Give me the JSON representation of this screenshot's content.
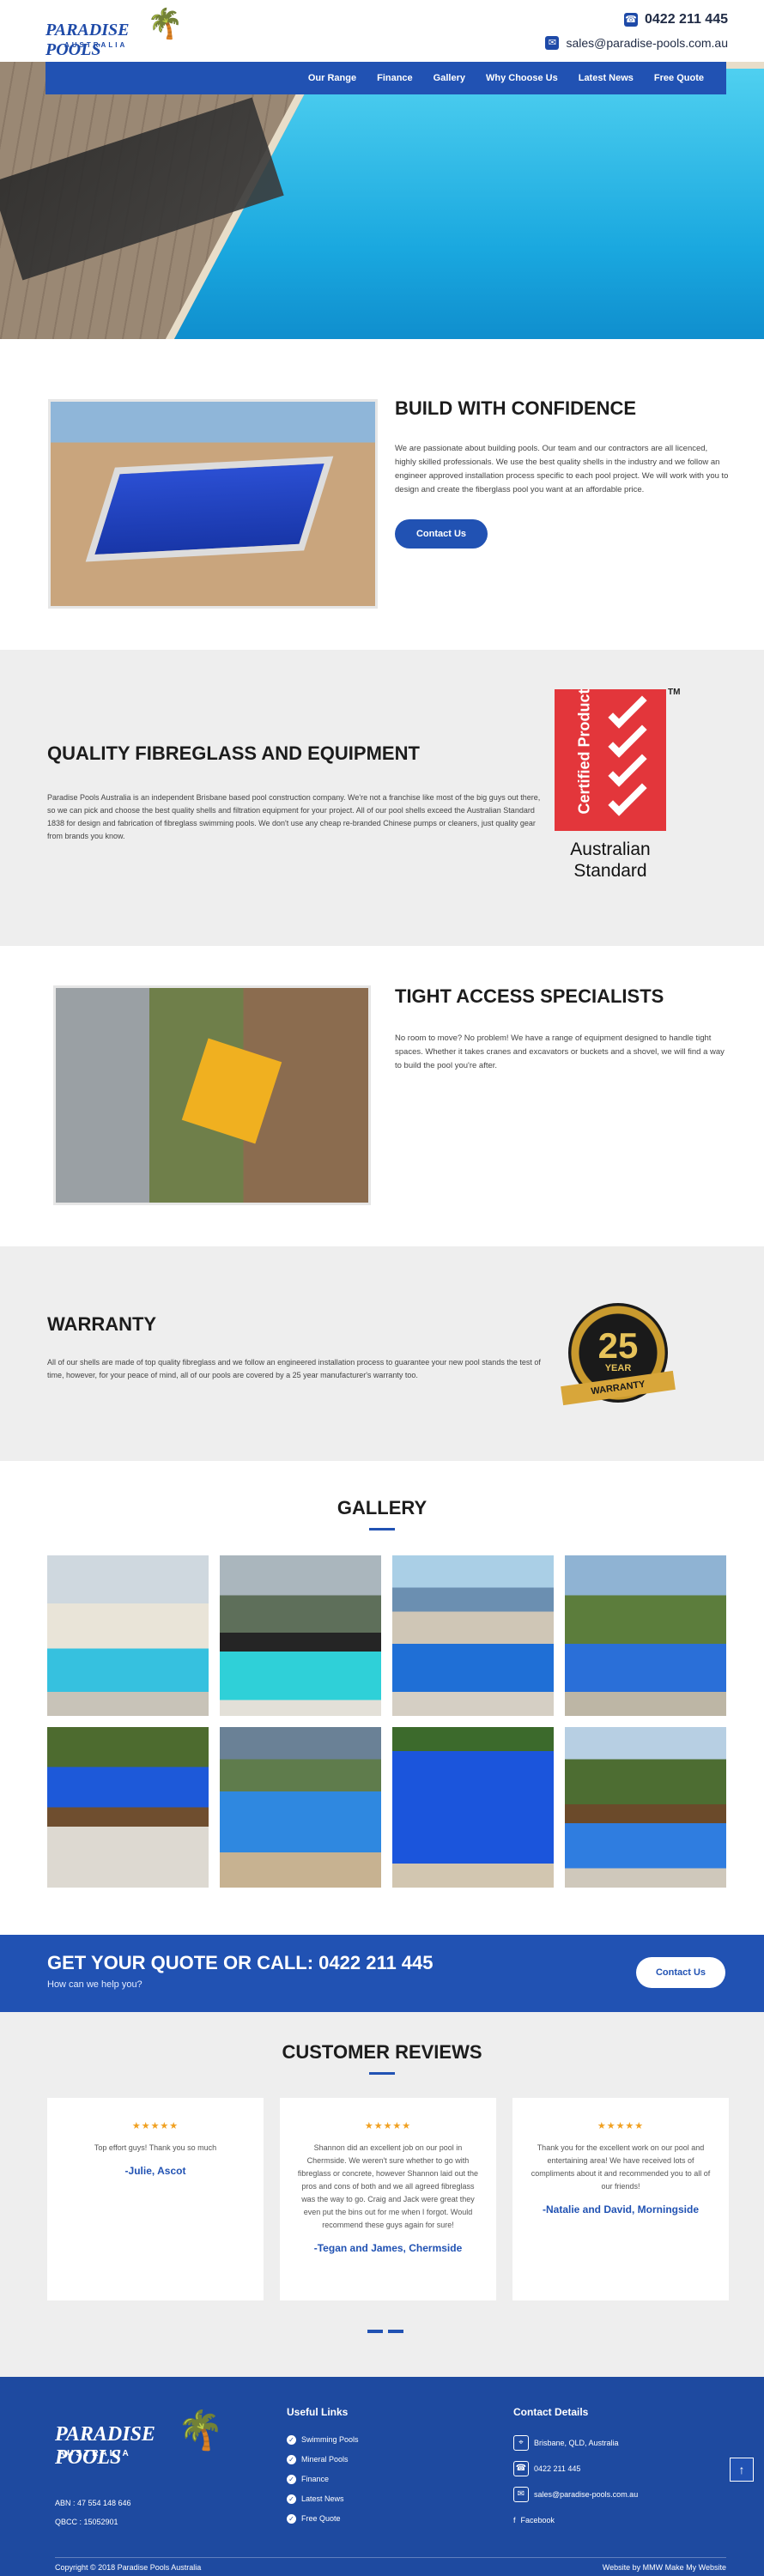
{
  "header": {
    "logo_text": "PARADISE POOLS",
    "logo_subtext": "AUSTRALIA",
    "phone": "0422 211 445",
    "email": "sales@paradise-pools.com.au"
  },
  "nav": {
    "items": [
      {
        "label": "Our Range"
      },
      {
        "label": "Finance"
      },
      {
        "label": "Gallery"
      },
      {
        "label": "Why Choose Us"
      },
      {
        "label": "Latest News"
      },
      {
        "label": "Free Quote"
      }
    ]
  },
  "build": {
    "title": "BUILD WITH CONFIDENCE",
    "text": "We are passionate about building pools. Our team and our contractors are all licenced, highly skilled professionals. We use the best quality shells in the industry and we follow an engineer approved installation process specific to each pool project. We will work with you to design and create the fiberglass pool you want at an affordable price.",
    "button": "Contact Us"
  },
  "quality": {
    "title": "QUALITY FIBREGLASS AND EQUIPMENT",
    "text": "Paradise Pools Australia is an independent Brisbane based pool construction company. We're not a franchise like most of the big guys out there, so we can pick and choose the best quality shells and filtration equipment for your project. All of our pool shells exceed the Australian Standard 1838 for design and fabrication of fibreglass swimming pools. We don't use any cheap re-branded Chinese pumps or cleaners, just quality gear from brands you know.",
    "cert_vertical": "Certified Product",
    "cert_tm": "TM",
    "cert_line1": "Australian",
    "cert_line2": "Standard"
  },
  "tight": {
    "title": "TIGHT ACCESS SPECIALISTS",
    "text": "No room to move? No problem! We have a range of equipment designed to handle tight spaces. Whether it takes cranes and excavators or buckets and a shovel, we will find a way to build the pool you're after."
  },
  "warranty": {
    "title": "WARRANTY",
    "text": "All of our shells are made of top quality fibreglass and we follow an engineered installation process to guarantee your new pool stands the test of time, however, for your peace of mind, all of our pools are covered by a 25 year manufacturer's warranty too.",
    "badge_number": "25",
    "badge_year": "YEAR",
    "badge_ribbon": "WARRANTY"
  },
  "gallery": {
    "title": "GALLERY"
  },
  "cta": {
    "title": "GET YOUR QUOTE OR CALL: 0422 211 445",
    "subtitle": "How can we help you?",
    "button": "Contact Us"
  },
  "reviews": {
    "title": "CUSTOMER REVIEWS",
    "stars": "★★★★★",
    "items": [
      {
        "quote": "Top effort guys! Thank you so much",
        "author": "-Julie, Ascot"
      },
      {
        "quote": "Shannon did an excellent job on our pool in Chermside. We weren't sure whether to go with fibreglass or concrete, however Shannon laid out the pros and cons of both and we all agreed fibreglass was the way to go. Craig and Jack were great they even put the bins out for me when I forgot. Would recommend these guys again for sure!",
        "author": "-Tegan and James, Chermside"
      },
      {
        "quote": "Thank you for the excellent work on our pool and entertaining area! We have received lots of compliments about it and recommended you to all of our friends!",
        "author": "-Natalie and David, Morningside"
      }
    ]
  },
  "footer": {
    "logo_text": "PARADISE POOLS",
    "logo_subtext": "AUSTRALIA",
    "abn": "ABN : 47 554 148 646",
    "qbcc": "QBCC : 15052901",
    "useful_title": "Useful Links",
    "useful_links": [
      "Swimming Pools",
      "Mineral Pools",
      "Finance",
      "Latest News",
      "Free Quote"
    ],
    "contact_title": "Contact Details",
    "address": "Brisbane, QLD, Australia",
    "phone": "0422 211 445",
    "email": "sales@paradise-pools.com.au",
    "facebook": "Facebook",
    "copyright": "Copyright © 2018 Paradise Pools Australia",
    "credit": "Website by MMW Make My Website"
  },
  "icons": {
    "phone": "phone-icon",
    "email": "envelope-icon",
    "palm": "palm-tree-icon",
    "check": "check-circle-icon",
    "pin": "map-pin-icon",
    "facebook": "facebook-icon",
    "totop": "arrow-up-icon"
  },
  "colors": {
    "brand_blue": "#2152b3",
    "footer_blue": "#1e4aa0",
    "star": "#f0a020",
    "cert_red": "#e3363b"
  }
}
